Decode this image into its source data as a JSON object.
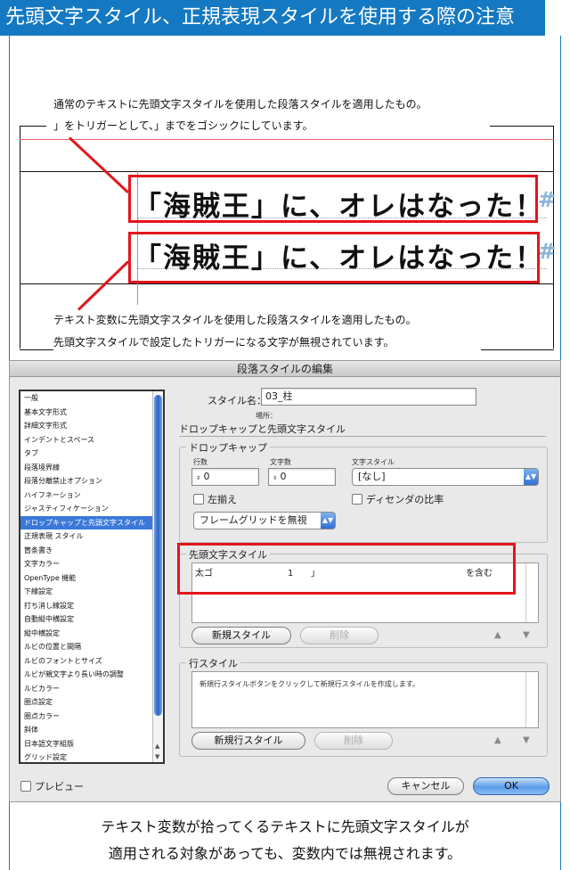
{
  "header": {
    "title": "先頭文字スタイル、正規表現スタイルを使用する際の注意"
  },
  "illustration": {
    "note_top_1": "通常のテキストに先頭文字スタイルを使用した段落スタイルを適用したもの。",
    "note_top_2": "」をトリガーとして、」までをゴシックにしています。",
    "sample_1": "「海賊王」に、オレはなった！",
    "sample_2": "「海賊王」に、オレはなった！",
    "hash_mark": "#",
    "note_bottom_1": "テキスト変数に先頭文字スタイルを使用した段落スタイルを適用したもの。",
    "note_bottom_2": "先頭文字スタイルで設定したトリガーになる文字が無視されています。"
  },
  "dialog": {
    "title": "段落スタイルの編集",
    "sidebar_items": [
      "一般",
      "基本文字形式",
      "詳細文字形式",
      "インデントとスペース",
      "タブ",
      "段落境界線",
      "段落分離禁止オプション",
      "ハイフネーション",
      "ジャスティフィケーション",
      "ドロップキャップと先頭文字スタイル",
      "正規表現 スタイル",
      "箇条書き",
      "文字カラー",
      "OpenType 機能",
      "下線設定",
      "打ち消し線設定",
      "自動縦中横設定",
      "縦中横設定",
      "ルビの位置と間隔",
      "ルビのフォントとサイズ",
      "ルビが親文字より長い時の調整",
      "ルビカラー",
      "圏点設定",
      "圏点カラー",
      "斜体",
      "日本語文字組版",
      "グリッド設定"
    ],
    "selected_index": 9,
    "style_name_label": "スタイル名：",
    "style_name_value": "03_柱",
    "location_label": "場所：",
    "section_heading": "ドロップキャップと先頭文字スタイル",
    "dropcap": {
      "group_title": "ドロップキャップ",
      "lines_label": "行数",
      "lines_value": "0",
      "chars_label": "文字数",
      "chars_value": "0",
      "charstyle_label": "文字スタイル",
      "charstyle_value": "[なし]",
      "align_left_label": "左揃え",
      "descender_label": "ディセンダの比率",
      "frame_grid_value": "フレームグリッドを無視"
    },
    "nested": {
      "group_title": "先頭文字スタイル",
      "row_style": "太ゴ",
      "row_count": "1",
      "row_char": "」",
      "row_mode": "を含む",
      "new_button": "新規スタイル",
      "delete_button": "削除"
    },
    "line_style": {
      "group_title": "行スタイル",
      "hint": "新規行スタイルボタンをクリックして新規行スタイルを作成します。",
      "new_button": "新規行スタイル",
      "delete_button": "削除"
    },
    "preview_label": "プレビュー",
    "cancel_button": "キャンセル",
    "ok_button": "OK"
  },
  "caption": {
    "line_1": "テキスト変数が拾ってくるテキストに先頭文字スタイルが",
    "line_2": "適用される対象があっても、変数内では無視されます。"
  }
}
